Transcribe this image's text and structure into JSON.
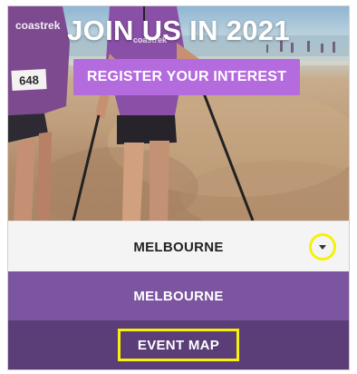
{
  "hero": {
    "title": "JOIN US IN 2021",
    "register_label": "REGISTER YOUR INTEREST",
    "bib_number": "648",
    "shirt_logo": "coastrek",
    "shirt_logo_small": "coastrek"
  },
  "location_select": {
    "selected": "MELBOURNE",
    "arrow_icon": "chevron-down-icon"
  },
  "menu": {
    "items": [
      {
        "label": "MELBOURNE"
      },
      {
        "label": "EVENT MAP"
      }
    ]
  },
  "colors": {
    "register_button": "#b46bde",
    "menu_item": "#7b559f",
    "menu_item_dark": "#5b3d78",
    "highlight": "#f6f10a"
  }
}
